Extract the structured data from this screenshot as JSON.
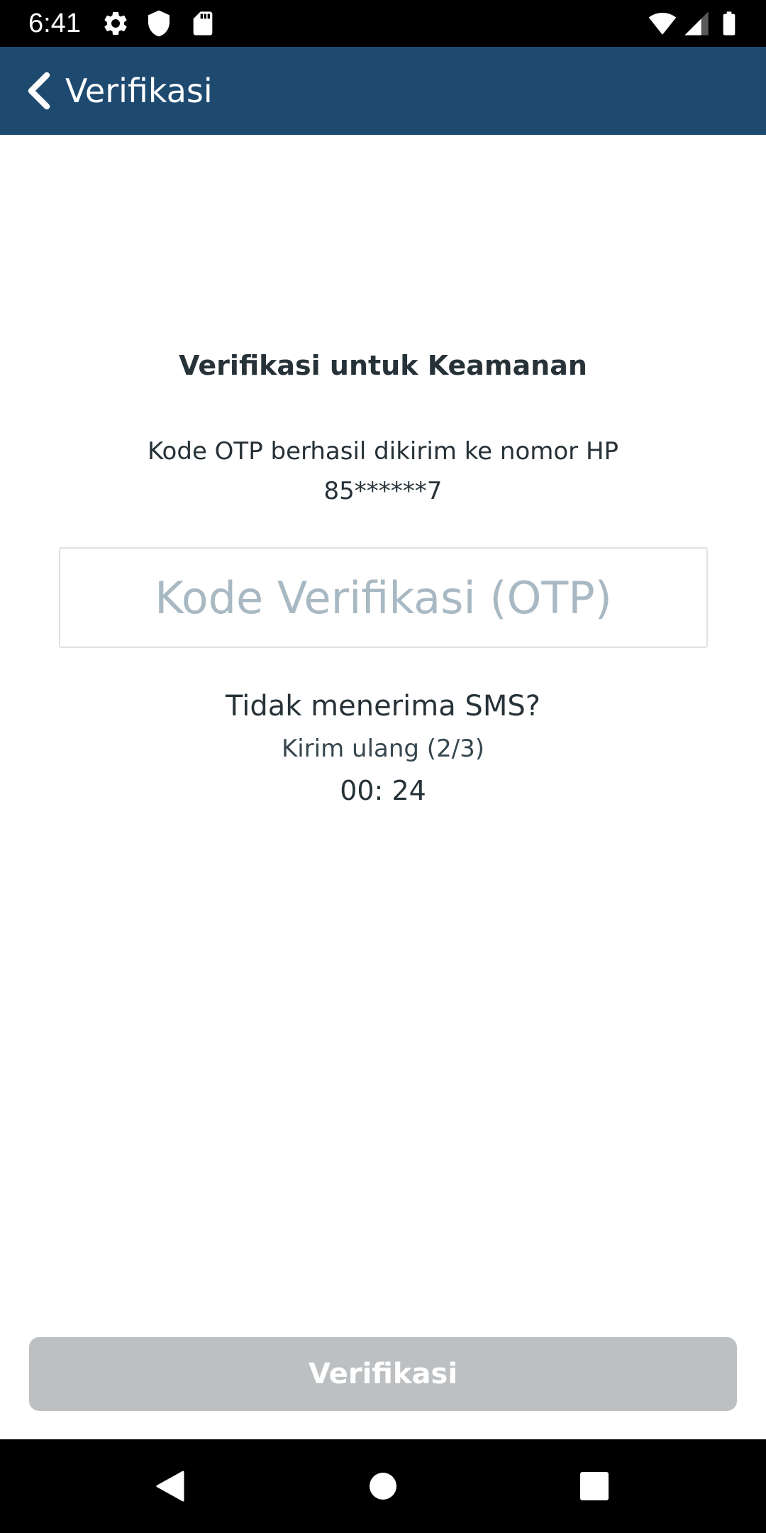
{
  "status_bar": {
    "time": "6:41",
    "left_icons": [
      "gear-icon",
      "shield-icon",
      "sd-card-icon"
    ],
    "right_icons": [
      "wifi-icon",
      "signal-icon",
      "battery-icon"
    ]
  },
  "app_bar": {
    "title": "Verifikasi",
    "background": "#1e4a70",
    "back_icon": "chevron-left-icon"
  },
  "main": {
    "heading": "Verifikasi untuk Keamanan",
    "info_line1": "Kode OTP berhasil dikirim ke nomor HP",
    "phone_masked": "85******7",
    "otp_input": {
      "value": "",
      "placeholder": "Kode Verifikasi (OTP)"
    },
    "no_sms_text": "Tidak menerima SMS?",
    "resend_label": "Kirim ulang  (2/3)",
    "countdown": "00: 24"
  },
  "footer": {
    "verify_label": "Verifikasi",
    "verify_color": "#bdc0c2"
  },
  "nav_bar": {
    "icons": [
      "back-triangle-icon",
      "home-circle-icon",
      "recents-square-icon"
    ]
  }
}
